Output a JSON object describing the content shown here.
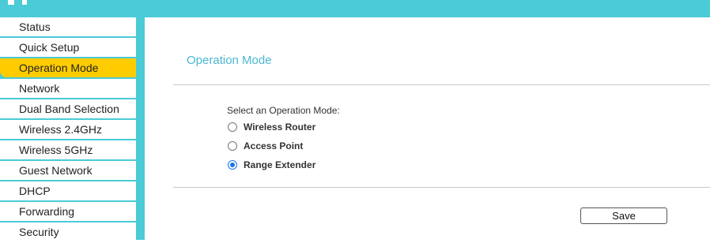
{
  "sidebar": {
    "items": [
      {
        "label": "Status"
      },
      {
        "label": "Quick Setup"
      },
      {
        "label": "Operation Mode",
        "active": true
      },
      {
        "label": "Network"
      },
      {
        "label": "Dual Band Selection"
      },
      {
        "label": "Wireless 2.4GHz"
      },
      {
        "label": "Wireless 5GHz"
      },
      {
        "label": "Guest Network"
      },
      {
        "label": "DHCP"
      },
      {
        "label": "Forwarding"
      },
      {
        "label": "Security"
      }
    ]
  },
  "main": {
    "title": "Operation Mode",
    "select_label": "Select an Operation Mode:",
    "options": [
      {
        "label": "Wireless Router",
        "checked": false
      },
      {
        "label": "Access Point",
        "checked": false
      },
      {
        "label": "Range Extender",
        "checked": true
      }
    ],
    "save_label": "Save"
  },
  "colors": {
    "header": "#4acbd6",
    "active_menu": "#ffcc00",
    "title": "#4ab8d2",
    "radio_checked": "#1a73e8"
  }
}
